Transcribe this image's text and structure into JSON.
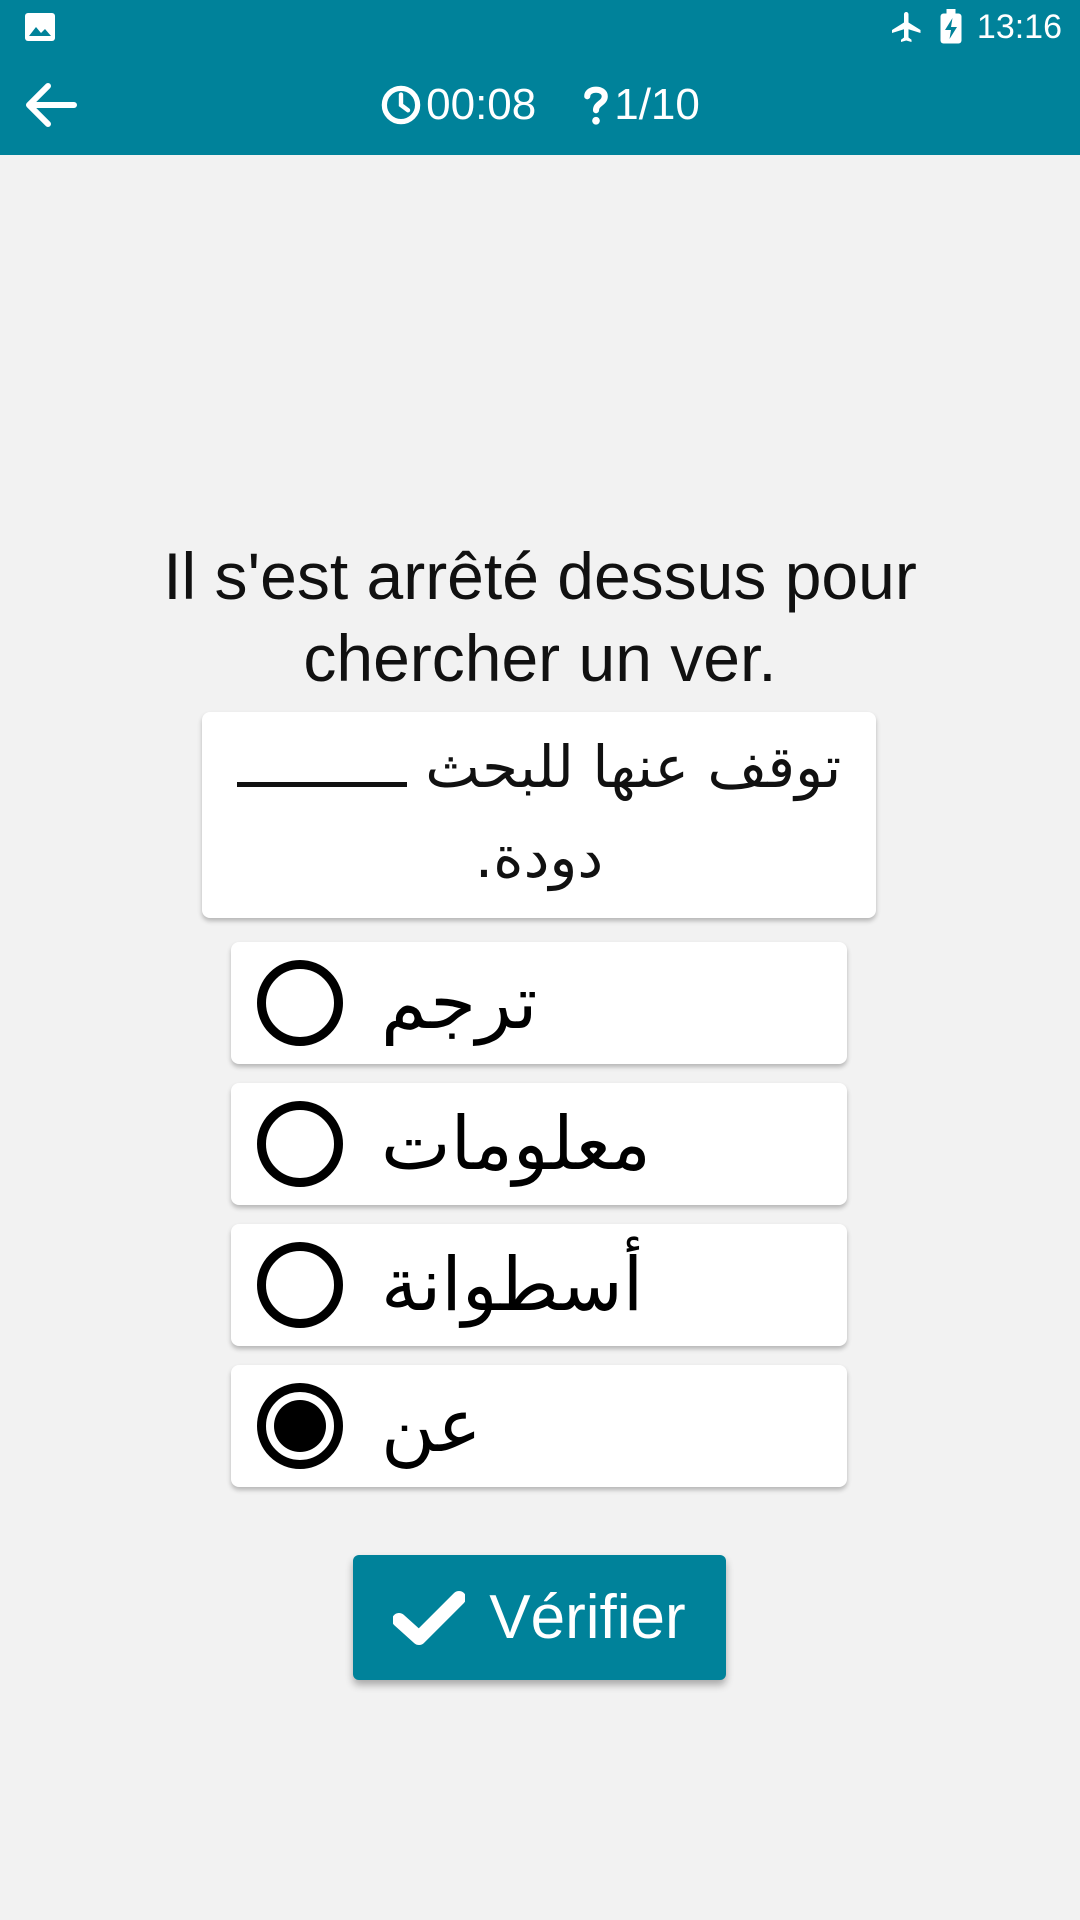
{
  "status_bar": {
    "time": "13:16",
    "icons": [
      "gallery-icon",
      "airplane-mode-icon",
      "battery-charging-icon"
    ]
  },
  "app_bar": {
    "back_icon": "arrow-back-icon",
    "timer_icon": "clock-icon",
    "timer": "00:08",
    "progress_icon": "question-mark-icon",
    "progress": "1/10"
  },
  "question": {
    "text": "Il s'est arrêté dessus pour chercher un ver.",
    "arabic_before_blank": "توقف عنها للبحث",
    "arabic_after_blank": "دودة."
  },
  "options": [
    {
      "label": "ترجم",
      "selected": false
    },
    {
      "label": "معلومات",
      "selected": false
    },
    {
      "label": "أسطوانة",
      "selected": false
    },
    {
      "label": "عن",
      "selected": true
    }
  ],
  "verify_button": {
    "label": "Vérifier",
    "icon": "checkmark-icon"
  },
  "colors": {
    "primary": "#00829a",
    "background": "#f2f2f2"
  }
}
